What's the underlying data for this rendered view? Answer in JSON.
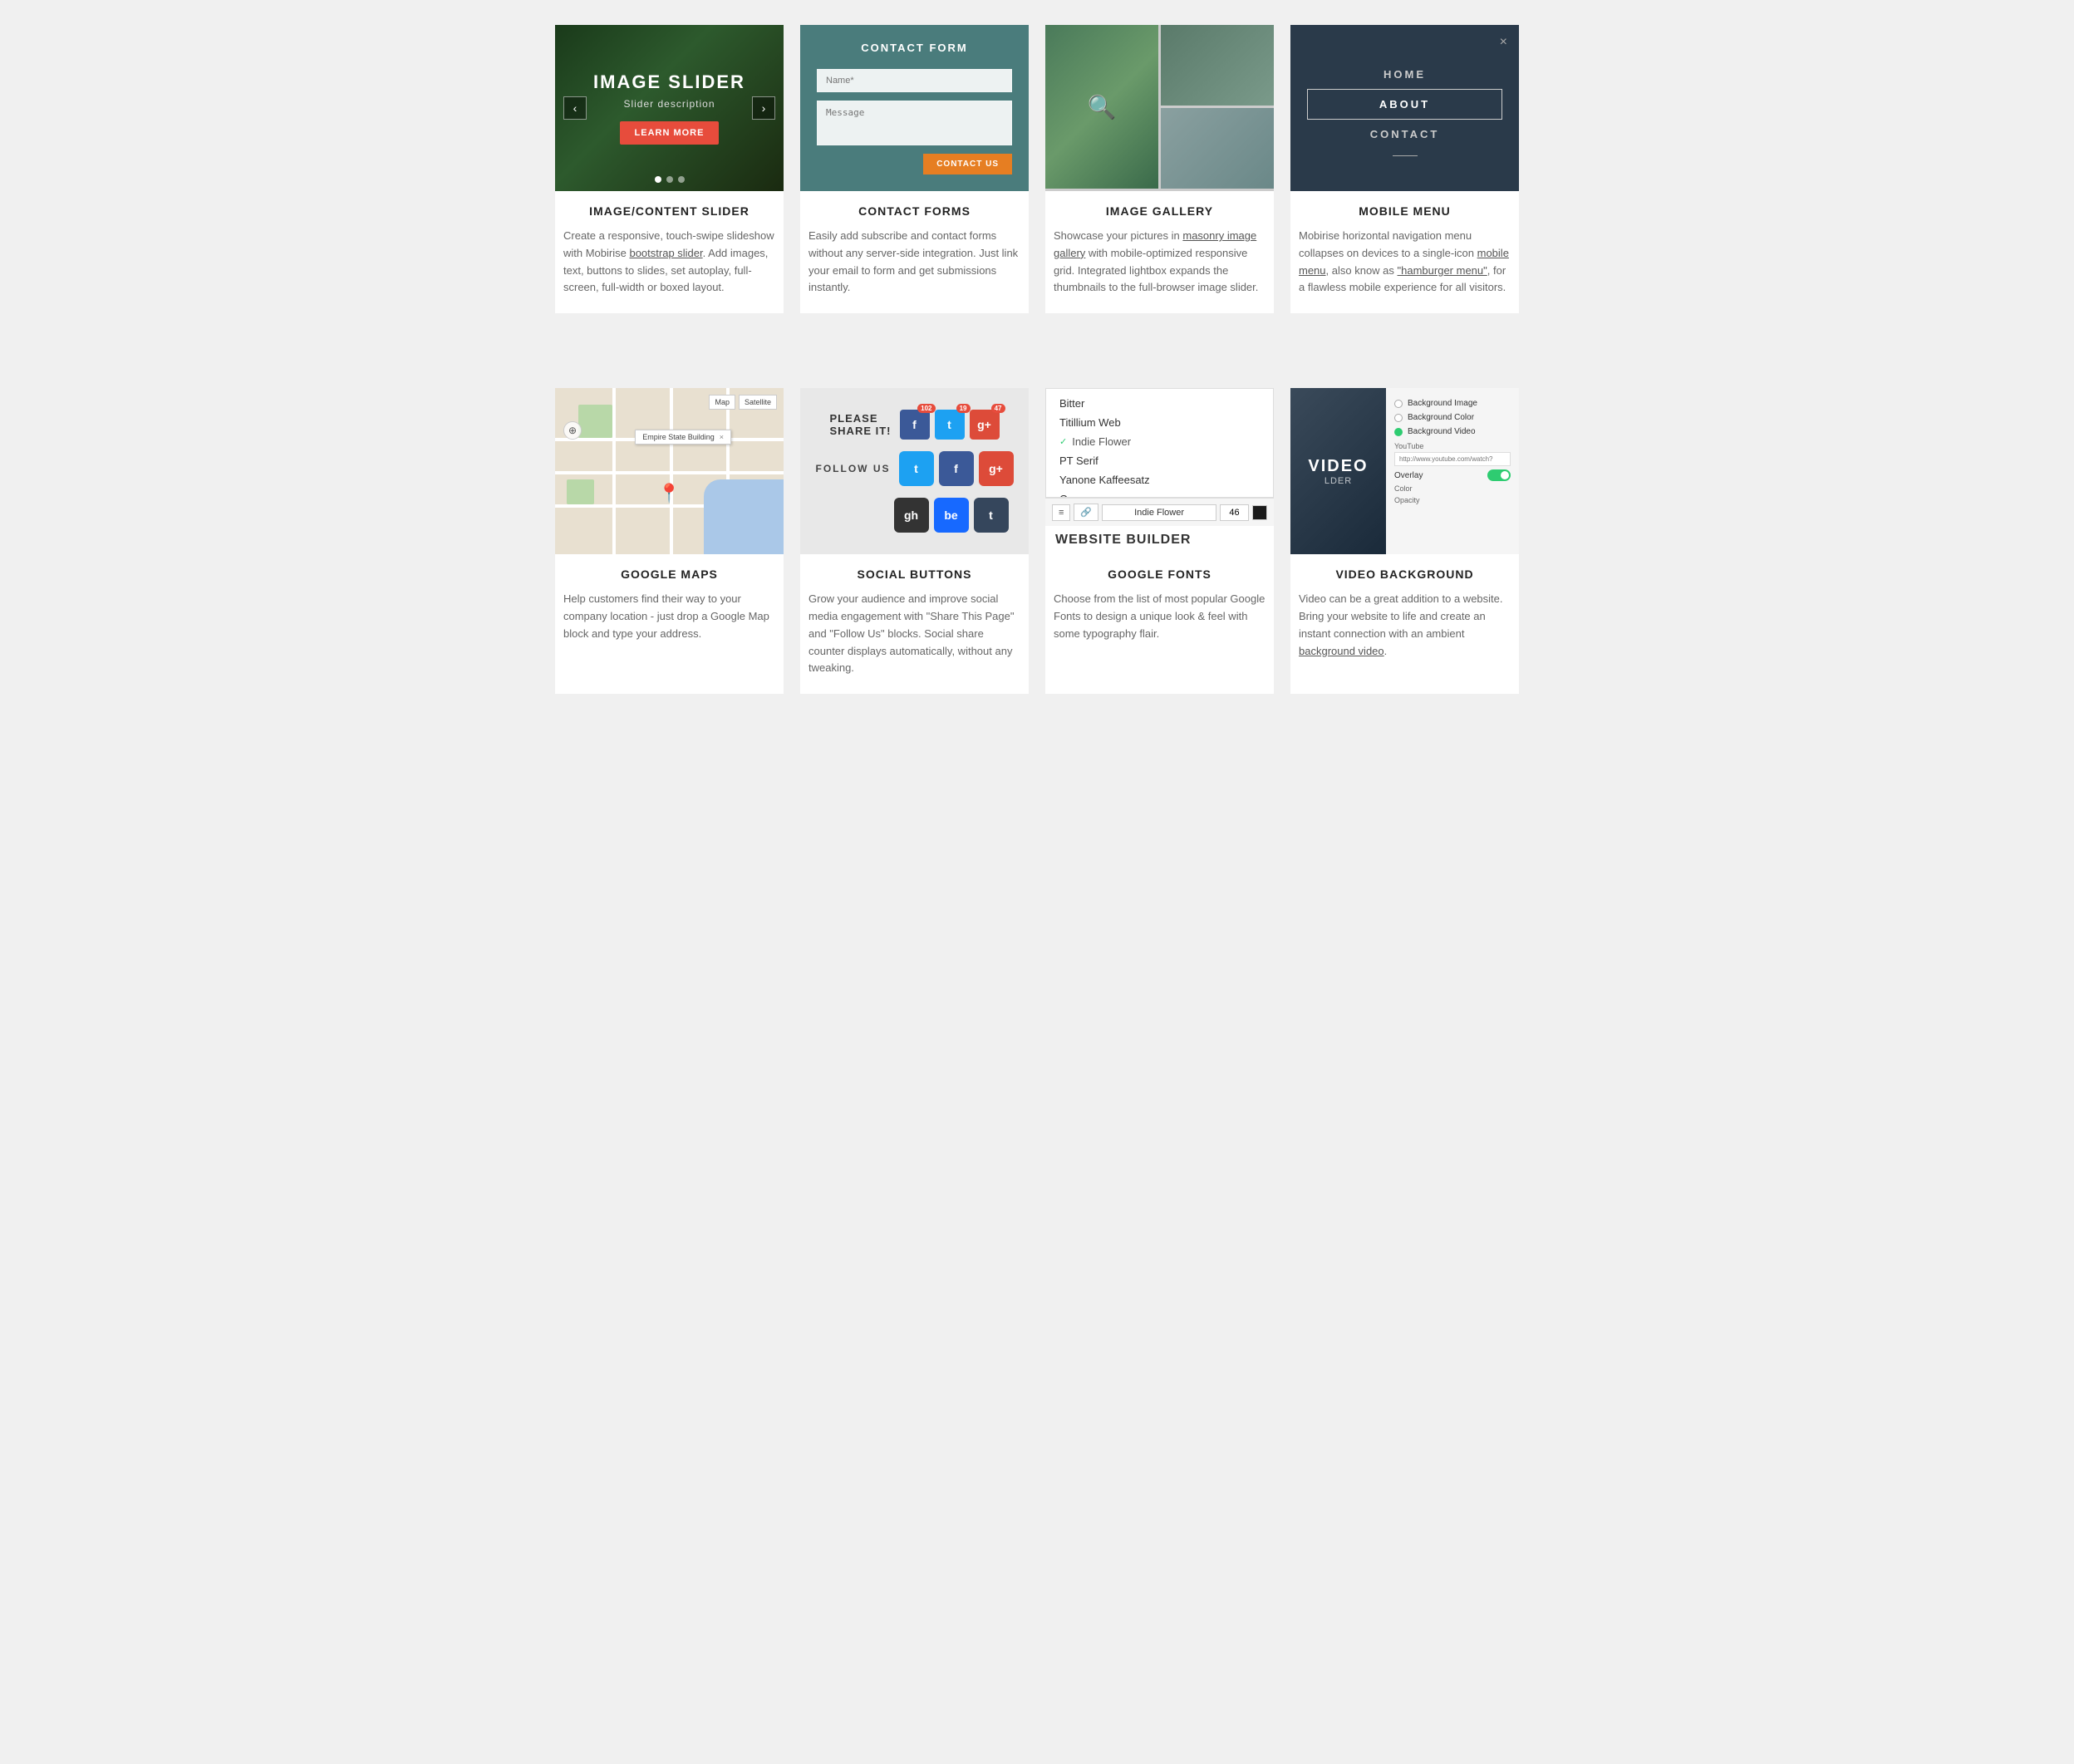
{
  "page": {
    "background": "#f0f0f0"
  },
  "row1": {
    "cards": [
      {
        "id": "image-slider",
        "title": "IMAGE/CONTENT SLIDER",
        "image_alt": "Image Slider Preview",
        "slider_title": "IMAGE SLIDER",
        "slider_desc": "Slider description",
        "slider_btn": "LEARN MORE",
        "description": "Create a responsive, touch-swipe slideshow with Mobirise ",
        "link1_text": "bootstrap slider",
        "link1_url": "#",
        "description2": ". Add images, text, buttons to slides, set autoplay, full-screen, full-width or boxed layout."
      },
      {
        "id": "contact-forms",
        "title": "CONTACT FORMS",
        "image_alt": "Contact Form Preview",
        "form_title": "CONTACT FORM",
        "name_placeholder": "Name*",
        "message_placeholder": "Message",
        "submit_label": "CONTACT US",
        "description": "Easily add subscribe and contact forms without any server-side integration. Just link your email to form and get submissions instantly."
      },
      {
        "id": "image-gallery",
        "title": "IMAGE GALLERY",
        "image_alt": "Image Gallery Preview",
        "description": "Showcase your pictures in ",
        "link1_text": "masonry image gallery",
        "link1_url": "#",
        "description2": " with mobile-optimized responsive grid. Integrated lightbox expands the thumbnails to the full-browser image slider."
      },
      {
        "id": "mobile-menu",
        "title": "MOBILE MENU",
        "image_alt": "Mobile Menu Preview",
        "menu_items": [
          "HOME",
          "ABOUT",
          "CONTACT"
        ],
        "active_item": "ABOUT",
        "description": "Mobirise horizontal navigation menu collapses on devices to a single-icon ",
        "link1_text": "mobile menu",
        "link1_url": "#",
        "description2": ", also know as ",
        "link2_text": "\"hamburger menu\"",
        "link2_url": "#",
        "description3": ", for a flawless mobile experience for all visitors."
      }
    ]
  },
  "row2": {
    "cards": [
      {
        "id": "google-maps",
        "title": "GOOGLE MAPS",
        "image_alt": "Google Maps Preview",
        "map_label": "Empire State Building",
        "map_controls": [
          "Map",
          "Satellite"
        ],
        "description": "Help customers find their way to your company location - just drop a Google Map block and type your address."
      },
      {
        "id": "social-buttons",
        "title": "SOCIAL BUTTONS",
        "image_alt": "Social Buttons Preview",
        "share_label": "PLEASE\nSHARE IT!",
        "follow_label": "FOLLOW US",
        "share_icons": [
          {
            "name": "Facebook",
            "short": "f",
            "count": "102",
            "color": "#3b5998"
          },
          {
            "name": "Twitter",
            "short": "t",
            "count": "19",
            "color": "#1da1f2"
          },
          {
            "name": "Google+",
            "short": "g+",
            "count": "47",
            "color": "#dd4b39"
          }
        ],
        "follow_icons": [
          {
            "name": "Twitter",
            "short": "t",
            "color": "#1da1f2"
          },
          {
            "name": "Facebook",
            "short": "f",
            "color": "#3b5998"
          },
          {
            "name": "Google+",
            "short": "g+",
            "color": "#dd4b39"
          },
          {
            "name": "GitHub",
            "short": "gh",
            "color": "#333"
          },
          {
            "name": "Behance",
            "short": "be",
            "color": "#1769ff"
          },
          {
            "name": "Tumblr",
            "short": "t2",
            "color": "#35465c"
          }
        ],
        "description": "Grow your audience and improve social media engagement with \"Share This Page\" and \"Follow Us\" blocks. Social share counter displays automatically, without any tweaking."
      },
      {
        "id": "google-fonts",
        "title": "GOOGLE FONTS",
        "image_alt": "Google Fonts Preview",
        "font_list": [
          "Bitter",
          "Titillium Web",
          "Indie Flower",
          "PT Serif",
          "Yanone Kaffeesatz",
          "Oxygen"
        ],
        "active_font": "Indie Flower",
        "font_size": "46",
        "main_text": "WEBSITE BUILDER",
        "description": "Choose from the list of most popular Google Fonts to design a unique look & feel with some typography flair."
      },
      {
        "id": "video-background",
        "title": "VIDEO BACKGROUND",
        "image_alt": "Video Background Preview",
        "video_text": "VIDEO",
        "video_subtext": "LDER",
        "options": [
          {
            "label": "Background Image",
            "active": false
          },
          {
            "label": "Background Color",
            "active": false
          },
          {
            "label": "Background Video",
            "active": true
          }
        ],
        "youtube_label": "YouTube",
        "youtube_placeholder": "http://www.youtube.com/watch?",
        "overlay_label": "Overlay",
        "color_label": "Color",
        "opacity_label": "Opacity",
        "description": "Video can be a great addition to a website. Bring your website to life and create an instant connection with an ambient ",
        "link1_text": "background video",
        "link1_url": "#",
        "description2": "."
      }
    ]
  }
}
